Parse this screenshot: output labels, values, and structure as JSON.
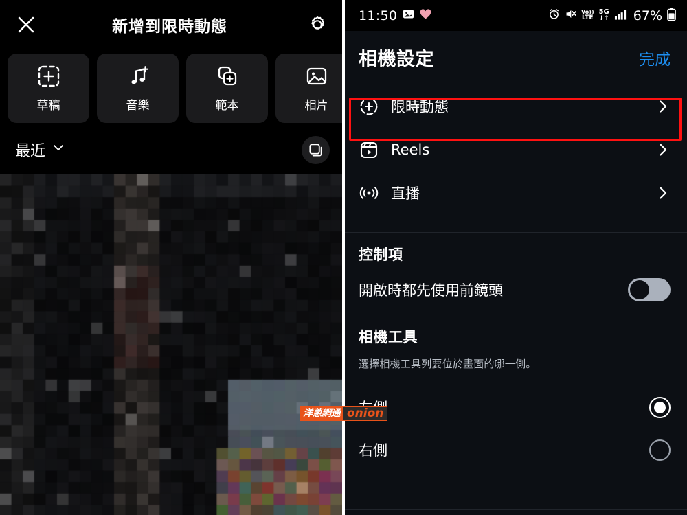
{
  "left_panel": {
    "topbar": {
      "close_icon": "close-icon",
      "title": "新增到限時動態",
      "settings_icon": "gear-icon"
    },
    "quick_actions": [
      {
        "label": "草稿",
        "icon": "dashed-square-plus-icon"
      },
      {
        "label": "音樂",
        "icon": "music-note-plus-icon"
      },
      {
        "label": "範本",
        "icon": "stacked-squares-plus-icon"
      },
      {
        "label": "相片",
        "icon": "photo-icon"
      }
    ],
    "gallery": {
      "album_label": "最近",
      "album_chevron_icon": "chevron-down-icon",
      "multiselect_icon": "multi-select-layers-icon"
    }
  },
  "right_panel": {
    "statusbar": {
      "time": "11:50",
      "left_icons": [
        "photo-icon",
        "heart-icon"
      ],
      "right_icons": [
        "alarm-icon",
        "mute-icon",
        "volte-icon",
        "5g-icon",
        "signal-bars-icon"
      ],
      "volte_top": "Vo))",
      "volte_bottom": "LTE",
      "network_top": "5G",
      "network_bottom": "↓↑",
      "battery_percent": "67%",
      "battery_icon": "battery-icon"
    },
    "header": {
      "title": "相機設定",
      "done_label": "完成",
      "done_color": "#1d8ef0"
    },
    "mode_rows": [
      {
        "label": "限時動態",
        "icon": "story-circle-plus-icon",
        "chevron": "chevron-right-icon",
        "highlighted": true
      },
      {
        "label": "Reels",
        "icon": "reels-clapper-icon",
        "chevron": "chevron-right-icon",
        "highlighted": false
      },
      {
        "label": "直播",
        "icon": "live-broadcast-icon",
        "chevron": "chevron-right-icon",
        "highlighted": false
      }
    ],
    "controls_section": {
      "title": "控制項",
      "toggle_label": "開啟時都先使用前鏡頭",
      "toggle_state": "off"
    },
    "camera_tools_section": {
      "title": "相機工具",
      "description": "選擇相機工具列要位於畫面的哪一側。",
      "options": [
        {
          "label": "左側",
          "selected": true
        },
        {
          "label": "右側",
          "selected": false
        }
      ]
    },
    "highlight_color": "#ff1111"
  },
  "watermark": {
    "cn_text": "洋蔥網通",
    "en_text": "onion",
    "accent_color": "#e8531a"
  }
}
